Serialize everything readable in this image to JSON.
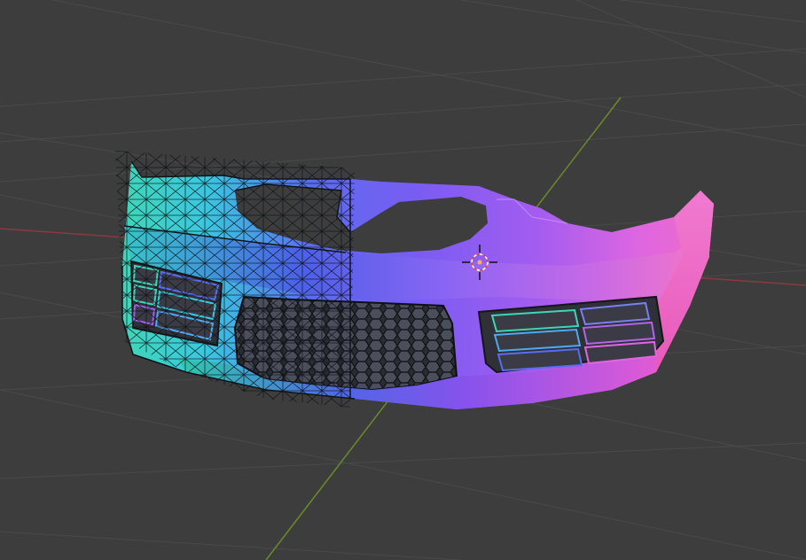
{
  "viewport": {
    "background": "#3d3d3d",
    "grid_line_color": "#4a4a4a",
    "x_axis_color": "#8a3b3f",
    "y_axis_color": "#6b8a2a",
    "wireframe_color": "#101418"
  },
  "scene": {
    "object": "car-front-bumper",
    "shading": "normal-map",
    "normal_colors": [
      "#3fd6b8",
      "#39c8e0",
      "#5a6df0",
      "#7a5cf2",
      "#a35cf0",
      "#e066e0",
      "#f06cc4"
    ],
    "wireframe_overlay": "left-half",
    "grille": "honeycomb-mesh",
    "fog_light_vents": "slatted",
    "cursor_3d": "3d-cursor-icon"
  }
}
